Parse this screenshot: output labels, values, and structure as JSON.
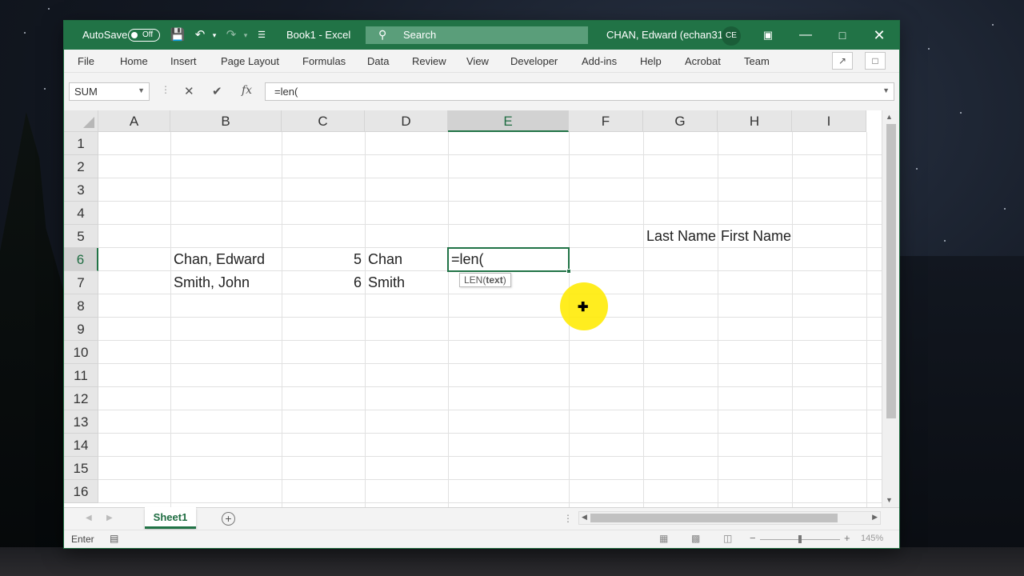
{
  "window": {
    "app_title": "Book1  -  Excel",
    "autosave_label": "AutoSave",
    "autosave_state": "Off",
    "search_label": "Search",
    "user_name": "CHAN, Edward (echan31)",
    "user_initials": "CE"
  },
  "menu": {
    "items": [
      "File",
      "Home",
      "Insert",
      "Page Layout",
      "Formulas",
      "Data",
      "Review",
      "View",
      "Developer",
      "Add-ins",
      "Help",
      "Acrobat",
      "Team"
    ]
  },
  "formula_bar": {
    "name_box": "SUM",
    "fx_label": "fx",
    "formula": "=len("
  },
  "sheet": {
    "columns": [
      "A",
      "B",
      "C",
      "D",
      "E",
      "F",
      "G",
      "H",
      "I"
    ],
    "rows": [
      "1",
      "2",
      "3",
      "4",
      "5",
      "6",
      "7",
      "8",
      "9",
      "10",
      "11",
      "12",
      "13",
      "14",
      "15",
      "16"
    ],
    "active_column": "E",
    "active_row": "6",
    "cells": {
      "G5": "Last Name",
      "H5": "First Name",
      "B6": "Chan, Edward",
      "C6": "5",
      "D6": "Chan",
      "B7": "Smith, John",
      "C7": "6",
      "D7": "Smith"
    },
    "editing_cell": "=len(",
    "tooltip_fn": "LEN(",
    "tooltip_arg": "text",
    "tooltip_close": ")"
  },
  "tabs": {
    "sheet_name": "Sheet1"
  },
  "status": {
    "mode": "Enter",
    "zoom": "145%"
  },
  "colors": {
    "excel_green": "#217346",
    "cursor_highlight": "#ffeb00"
  }
}
